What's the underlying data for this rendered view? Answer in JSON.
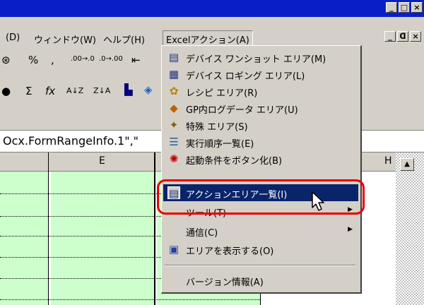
{
  "window_buttons": {
    "minimize": "_",
    "maximize": "□",
    "close": "×"
  },
  "mdi_buttons": {
    "minimize": "_",
    "restore": "ᗡ",
    "close": "×"
  },
  "menubar": {
    "items": [
      {
        "label": "(D)"
      },
      {
        "label": "ウィンドウ(W)"
      },
      {
        "label": "ヘルプ(H)"
      },
      {
        "label": "Excelアクション(A)"
      }
    ]
  },
  "toolbar1": {
    "percent": "%",
    "comma": ",",
    "dec_inc": ".00→.0",
    "dec_dec": ".0→.00"
  },
  "toolbar2": {
    "sigma": "Σ",
    "fx": "fx",
    "sort_asc": "A↓Z",
    "sort_desc": "Z↓A"
  },
  "formula_bar": {
    "text": "Ocx.FormRangeInfo.1\",\""
  },
  "column_headers": {
    "e": "E",
    "h": "H"
  },
  "dropdown": {
    "items": [
      {
        "label": "デバイス ワンショット エリア(M)",
        "icon": "device-oneshot-icon"
      },
      {
        "label": "デバイス ロギング エリア(L)",
        "icon": "device-logging-icon"
      },
      {
        "label": "レシピ エリア(R)",
        "icon": "recipe-icon"
      },
      {
        "label": "GP内ログデータ エリア(U)",
        "icon": "gp-logdata-icon"
      },
      {
        "label": "特殊 エリア(S)",
        "icon": "special-area-icon"
      },
      {
        "label": "実行順序一覧(E)",
        "icon": "execution-order-icon"
      },
      {
        "label": "起動条件をボタン化(B)",
        "icon": "startup-button-icon"
      },
      {
        "label": "アクションエリア一覧(I)",
        "icon": "action-area-list-icon",
        "highlighted": true
      },
      {
        "label": "ツール(T)",
        "submenu": true
      },
      {
        "label": "通信(C)",
        "submenu": true
      },
      {
        "label": "エリアを表示する(O)",
        "icon": "show-area-icon"
      },
      {
        "label": "バージョン情報(A)"
      }
    ]
  },
  "colors": {
    "title_bar": "#0a1ec8",
    "highlight": "#0a246a",
    "grid_green": "#ccffcc",
    "callout": "#e60000"
  }
}
